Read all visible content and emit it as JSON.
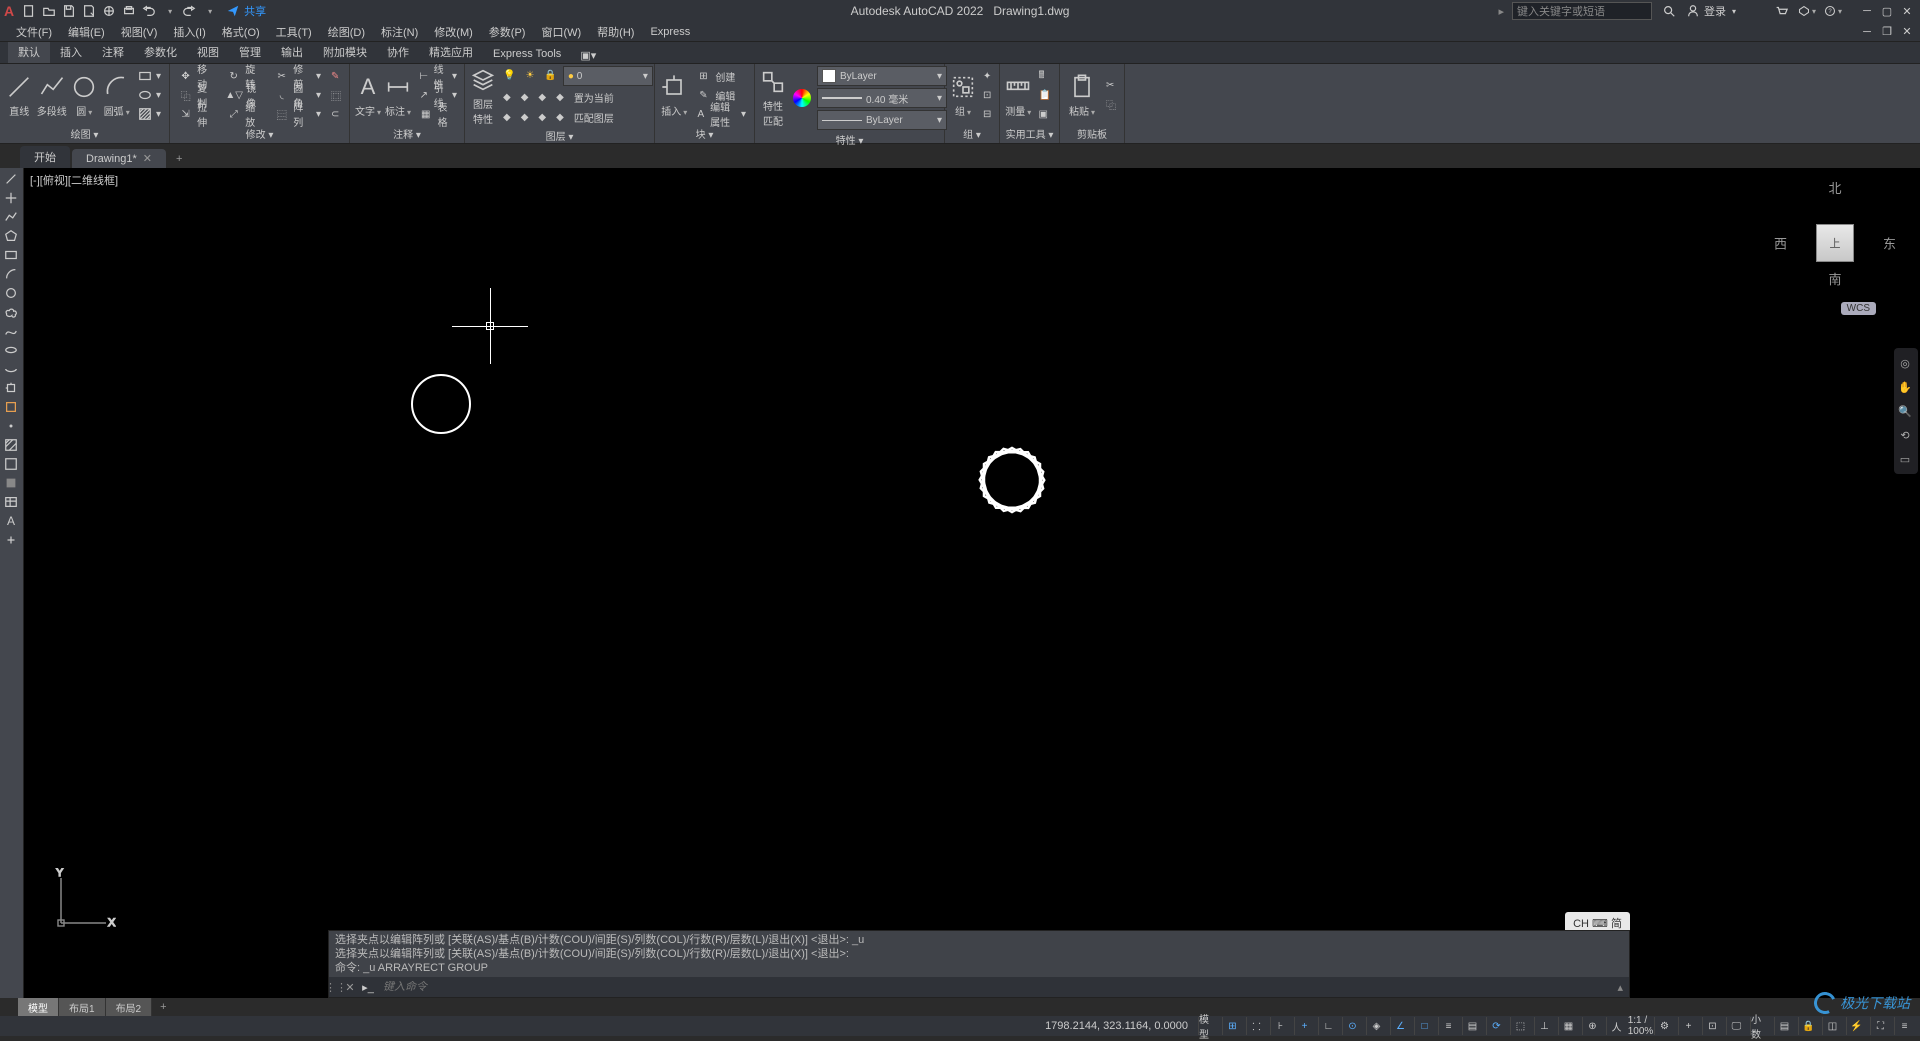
{
  "app_title": "Autodesk AutoCAD 2022",
  "doc_title": "Drawing1.dwg",
  "share_label": "共享",
  "search_placeholder": "键入关键字或短语",
  "login_label": "登录",
  "menubar": [
    "文件(F)",
    "编辑(E)",
    "视图(V)",
    "插入(I)",
    "格式(O)",
    "工具(T)",
    "绘图(D)",
    "标注(N)",
    "修改(M)",
    "参数(P)",
    "窗口(W)",
    "帮助(H)",
    "Express"
  ],
  "ribbon_tabs": [
    "默认",
    "插入",
    "注释",
    "参数化",
    "视图",
    "管理",
    "输出",
    "附加模块",
    "协作",
    "精选应用",
    "Express Tools"
  ],
  "panels": {
    "draw": {
      "label": "绘图 ▾",
      "btns": {
        "line": "直线",
        "polyline": "多段线",
        "circle": "圆",
        "arc": "圆弧"
      }
    },
    "modify": {
      "label": "修改 ▾",
      "btns": {
        "move": "移动",
        "copy": "复制",
        "stretch": "拉伸",
        "rotate": "旋转",
        "mirror": "镜像",
        "scale": "缩放",
        "trim": "修剪",
        "fillet": "圆角",
        "array": "阵列"
      }
    },
    "annot": {
      "label": "注释 ▾",
      "btns": {
        "text": "文字",
        "dim": "标注",
        "linear": "线性",
        "leader": "引线",
        "table": "表格"
      }
    },
    "layer": {
      "label": "图层 ▾",
      "btns": {
        "props": "图层\n特性",
        "current": "置为当前",
        "match": "匹配图层"
      },
      "dd": "0"
    },
    "block": {
      "label": "块 ▾",
      "btns": {
        "insert": "插入",
        "create": "创建",
        "edit": "编辑",
        "attr": "编辑属性"
      }
    },
    "props": {
      "label": "特性 ▾",
      "btns": {
        "match": "特性\n匹配"
      },
      "layer": "ByLayer",
      "lw": "0.40 毫米",
      "lt": "ByLayer"
    },
    "group": {
      "label": "组 ▾",
      "btn": "组"
    },
    "util": {
      "label": "实用工具 ▾",
      "btn": "测量"
    },
    "clip": {
      "label": "剪贴板",
      "btn": "粘贴"
    }
  },
  "filetabs": {
    "start": "开始",
    "doc": "Drawing1*"
  },
  "viewport_label": "[-][俯视][二维线框]",
  "viewcube": {
    "n": "北",
    "s": "南",
    "e": "东",
    "w": "西",
    "top": "上",
    "wcs": "WCS"
  },
  "ucs": {
    "x": "X",
    "y": "Y"
  },
  "cmd_history": [
    "选择夹点以编辑阵列或 [关联(AS)/基点(B)/计数(COU)/间距(S)/列数(COL)/行数(R)/层数(L)/退出(X)] <退出>: _u",
    "选择夹点以编辑阵列或 [关联(AS)/基点(B)/计数(COU)/间距(S)/列数(COL)/行数(R)/层数(L)/退出(X)] <退出>:",
    "命令: _u ARRAYRECT GROUP"
  ],
  "cmd_placeholder": "键入命令",
  "ime_badge": "CH ⌨ 简",
  "layout_tabs": [
    "模型",
    "布局1",
    "布局2"
  ],
  "status": {
    "coords": "1798.2144, 323.1164, 0.0000",
    "model": "模型",
    "scale": "1:1 / 100%",
    "decimal": "小数"
  },
  "watermark": "极光下载站"
}
